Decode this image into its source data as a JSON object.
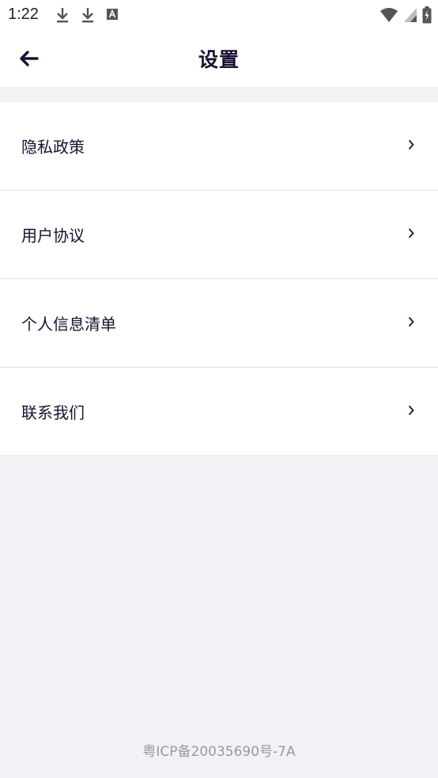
{
  "status_bar": {
    "time": "1:22",
    "left_icons": [
      "download-icon",
      "download-icon",
      "text-a-icon"
    ],
    "right_icons": [
      "wifi-icon",
      "signal-icon",
      "battery-icon"
    ]
  },
  "header": {
    "title": "设置",
    "back_icon": "arrow-left-icon"
  },
  "menu": {
    "items": [
      {
        "label": "隐私政策"
      },
      {
        "label": "用户协议"
      },
      {
        "label": "个人信息清单"
      },
      {
        "label": "联系我们"
      }
    ]
  },
  "footer": {
    "icp": "粤ICP备20035690号-7A"
  },
  "colors": {
    "background": "#f2f1f5",
    "surface": "#ffffff",
    "text_primary": "#1a1030",
    "text_footer": "#9a98a3",
    "divider": "#e0dfe4"
  }
}
